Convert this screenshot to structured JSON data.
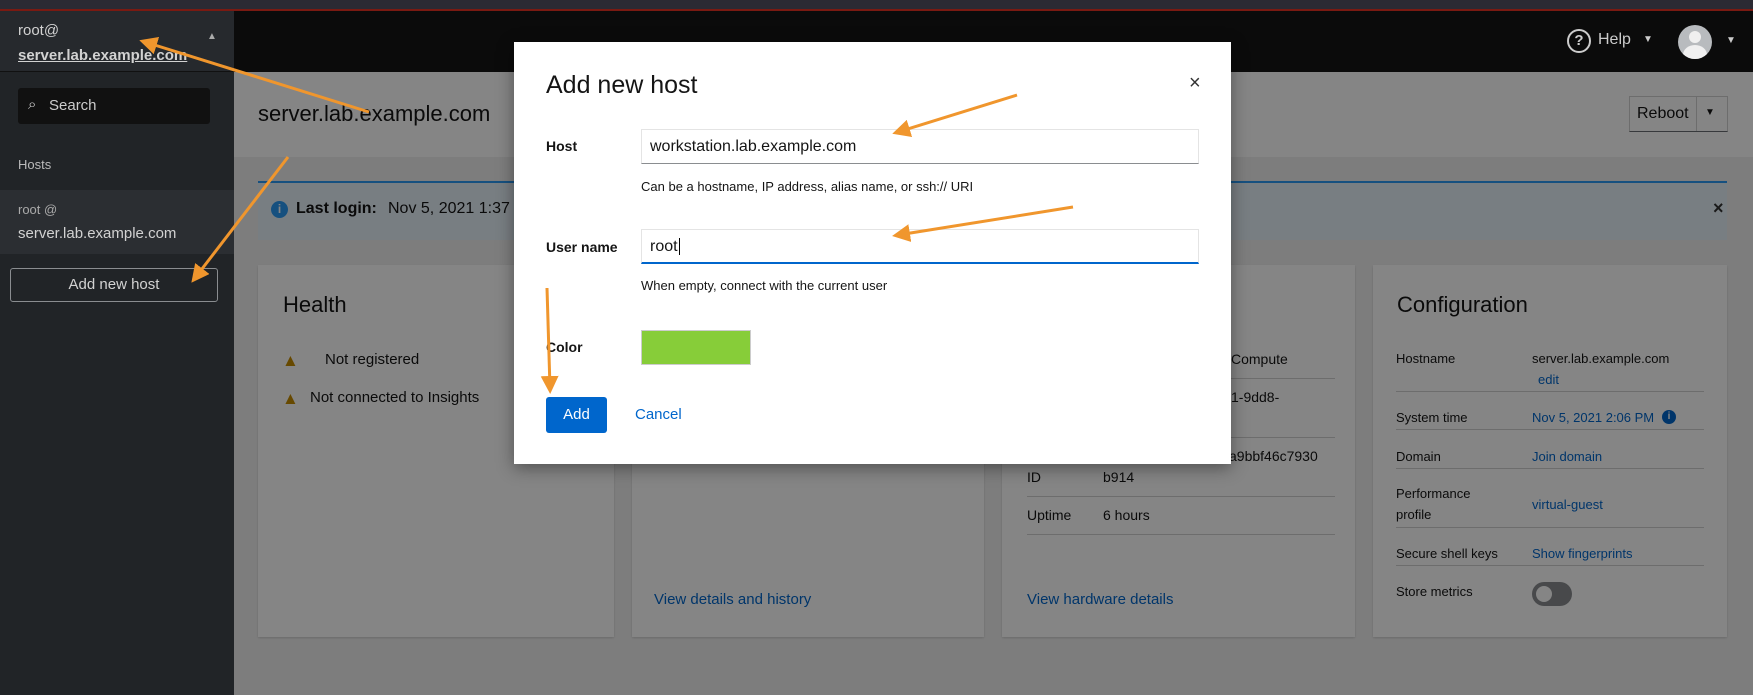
{
  "sidebar": {
    "current_user": "root@",
    "current_host": "server.lab.example.com",
    "search_placeholder": "Search",
    "hosts_heading": "Hosts",
    "host_items": [
      {
        "user": "root @",
        "host": "server.lab.example.com"
      }
    ],
    "add_host_label": "Add new host"
  },
  "topbar": {
    "help_label": "Help"
  },
  "main": {
    "title": "server.lab.example.com",
    "reboot_label": "Reboot",
    "alert": {
      "label": "Last login:",
      "value": "Nov 5, 2021 1:37"
    },
    "health": {
      "title": "Health",
      "items": [
        "Not registered",
        "Not connected to Insights"
      ]
    },
    "usage": {
      "link": "View details and history"
    },
    "system_info": {
      "partial": [
        "Compute",
        "1-9dd8-",
        "a9bbf46c7930"
      ],
      "rows": [
        {
          "label": "ID",
          "value": "b914"
        },
        {
          "label": "Uptime",
          "value": "6 hours"
        }
      ],
      "link": "View hardware details"
    },
    "configuration": {
      "title": "Configuration",
      "hostname_label": "Hostname",
      "hostname_value": "server.lab.example.com",
      "hostname_edit": "edit",
      "system_time_label": "System time",
      "system_time_value": "Nov 5, 2021 2:06 PM",
      "domain_label": "Domain",
      "domain_value": "Join domain",
      "perf_label_1": "Performance",
      "perf_label_2": "profile",
      "perf_value": "virtual-guest",
      "ssh_label": "Secure shell keys",
      "ssh_value": "Show fingerprints",
      "metrics_label": "Store metrics",
      "metrics_enabled": false
    }
  },
  "dialog": {
    "title": "Add new host",
    "host_label": "Host",
    "host_value": "workstation.lab.example.com",
    "host_help": "Can be a hostname, IP address, alias name, or ssh:// URI",
    "user_label": "User name",
    "user_value": "root",
    "user_help": "When empty, connect with the current user",
    "color_label": "Color",
    "color_value": "#87cd39",
    "add_label": "Add",
    "cancel_label": "Cancel"
  },
  "colors": {
    "accent": "#0066cc",
    "annotation_arrow": "#f0962d",
    "warning": "#f0ab00"
  }
}
